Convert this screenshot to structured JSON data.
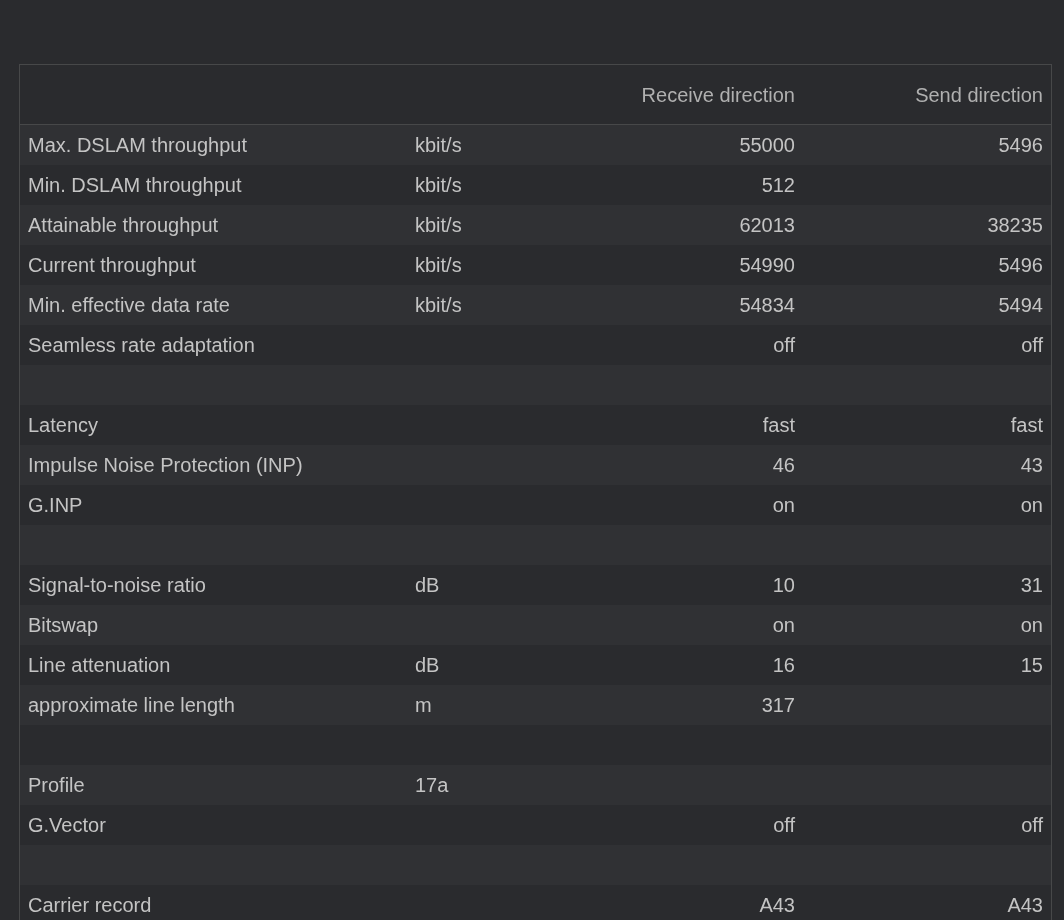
{
  "table": {
    "columns": [
      {
        "label": "Receive direction"
      },
      {
        "label": "Send direction"
      }
    ],
    "rows": [
      {
        "kind": "data",
        "label": "Max. DSLAM throughput",
        "unit": "kbit/s",
        "receive": "55000",
        "send": "5496"
      },
      {
        "kind": "data",
        "label": "Min. DSLAM throughput",
        "unit": "kbit/s",
        "receive": "512"
      },
      {
        "kind": "data",
        "label": "Attainable throughput",
        "unit": "kbit/s",
        "receive": "62013",
        "send": "38235"
      },
      {
        "kind": "data",
        "label": "Current throughput",
        "unit": "kbit/s",
        "receive": "54990",
        "send": "5496"
      },
      {
        "kind": "data",
        "label": "Min. effective data rate",
        "unit": "kbit/s",
        "receive": "54834",
        "send": "5494"
      },
      {
        "kind": "data",
        "label": "Seamless rate adaptation",
        "receive": "off",
        "send": "off"
      },
      {
        "kind": "spacer"
      },
      {
        "kind": "data",
        "label": "Latency",
        "receive": "fast",
        "send": "fast"
      },
      {
        "kind": "data",
        "label": "Impulse Noise Protection (INP)",
        "receive": "46",
        "send": "43"
      },
      {
        "kind": "data",
        "label": "G.INP",
        "receive": "on",
        "send": "on"
      },
      {
        "kind": "spacer"
      },
      {
        "kind": "data",
        "label": "Signal-to-noise ratio",
        "unit": "dB",
        "receive": "10",
        "send": "31"
      },
      {
        "kind": "data",
        "label": "Bitswap",
        "receive": "on",
        "send": "on"
      },
      {
        "kind": "data",
        "label": "Line attenuation",
        "unit": "dB",
        "receive": "16",
        "send": "15"
      },
      {
        "kind": "data",
        "label": "approximate line length",
        "unit": "m",
        "receive": "317"
      },
      {
        "kind": "spacer"
      },
      {
        "kind": "data",
        "label": "Profile",
        "unit": "17a"
      },
      {
        "kind": "data",
        "label": "G.Vector",
        "receive": "off",
        "send": "off"
      },
      {
        "kind": "spacer"
      },
      {
        "kind": "data",
        "label": "Carrier record",
        "receive": "A43",
        "send": "A43"
      }
    ]
  }
}
